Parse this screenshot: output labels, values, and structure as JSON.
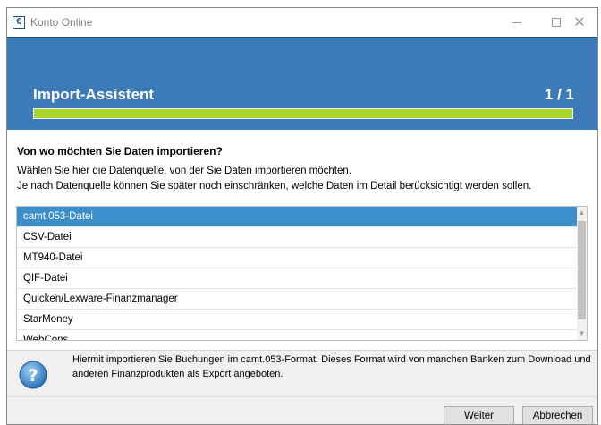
{
  "window": {
    "title": "Konto Online",
    "icon_glyph": "€"
  },
  "header": {
    "title": "Import-Assistent",
    "step": "1 / 1",
    "progress_fraction": 1.0,
    "progress_color": "#a8d62a",
    "background_color": "#3c7ab8"
  },
  "content": {
    "question": "Von wo möchten Sie Daten importieren?",
    "description_line1": "Wählen Sie hier die Datenquelle, von der Sie Daten importieren möchten.",
    "description_line2": "Je nach Datenquelle können Sie später noch einschränken, welche Daten im Detail berücksichtigt werden sollen."
  },
  "sources": {
    "items": [
      {
        "label": "camt.053-Datei",
        "selected": true
      },
      {
        "label": "CSV-Datei",
        "selected": false
      },
      {
        "label": "MT940-Datei",
        "selected": false
      },
      {
        "label": "QIF-Datei",
        "selected": false
      },
      {
        "label": "Quicken/Lexware-Finanzmanager",
        "selected": false
      },
      {
        "label": "StarMoney",
        "selected": false
      },
      {
        "label": "WebCons",
        "selected": false
      }
    ],
    "selected_color": "#3d8fcc"
  },
  "info": {
    "icon": "question-icon",
    "text": "Hiermit importieren Sie Buchungen im camt.053-Format. Dieses Format wird von manchen Banken zum Download und anderen Finanzprodukten als Export angeboten."
  },
  "footer": {
    "next_label": "Weiter",
    "cancel_label": "Abbrechen"
  }
}
